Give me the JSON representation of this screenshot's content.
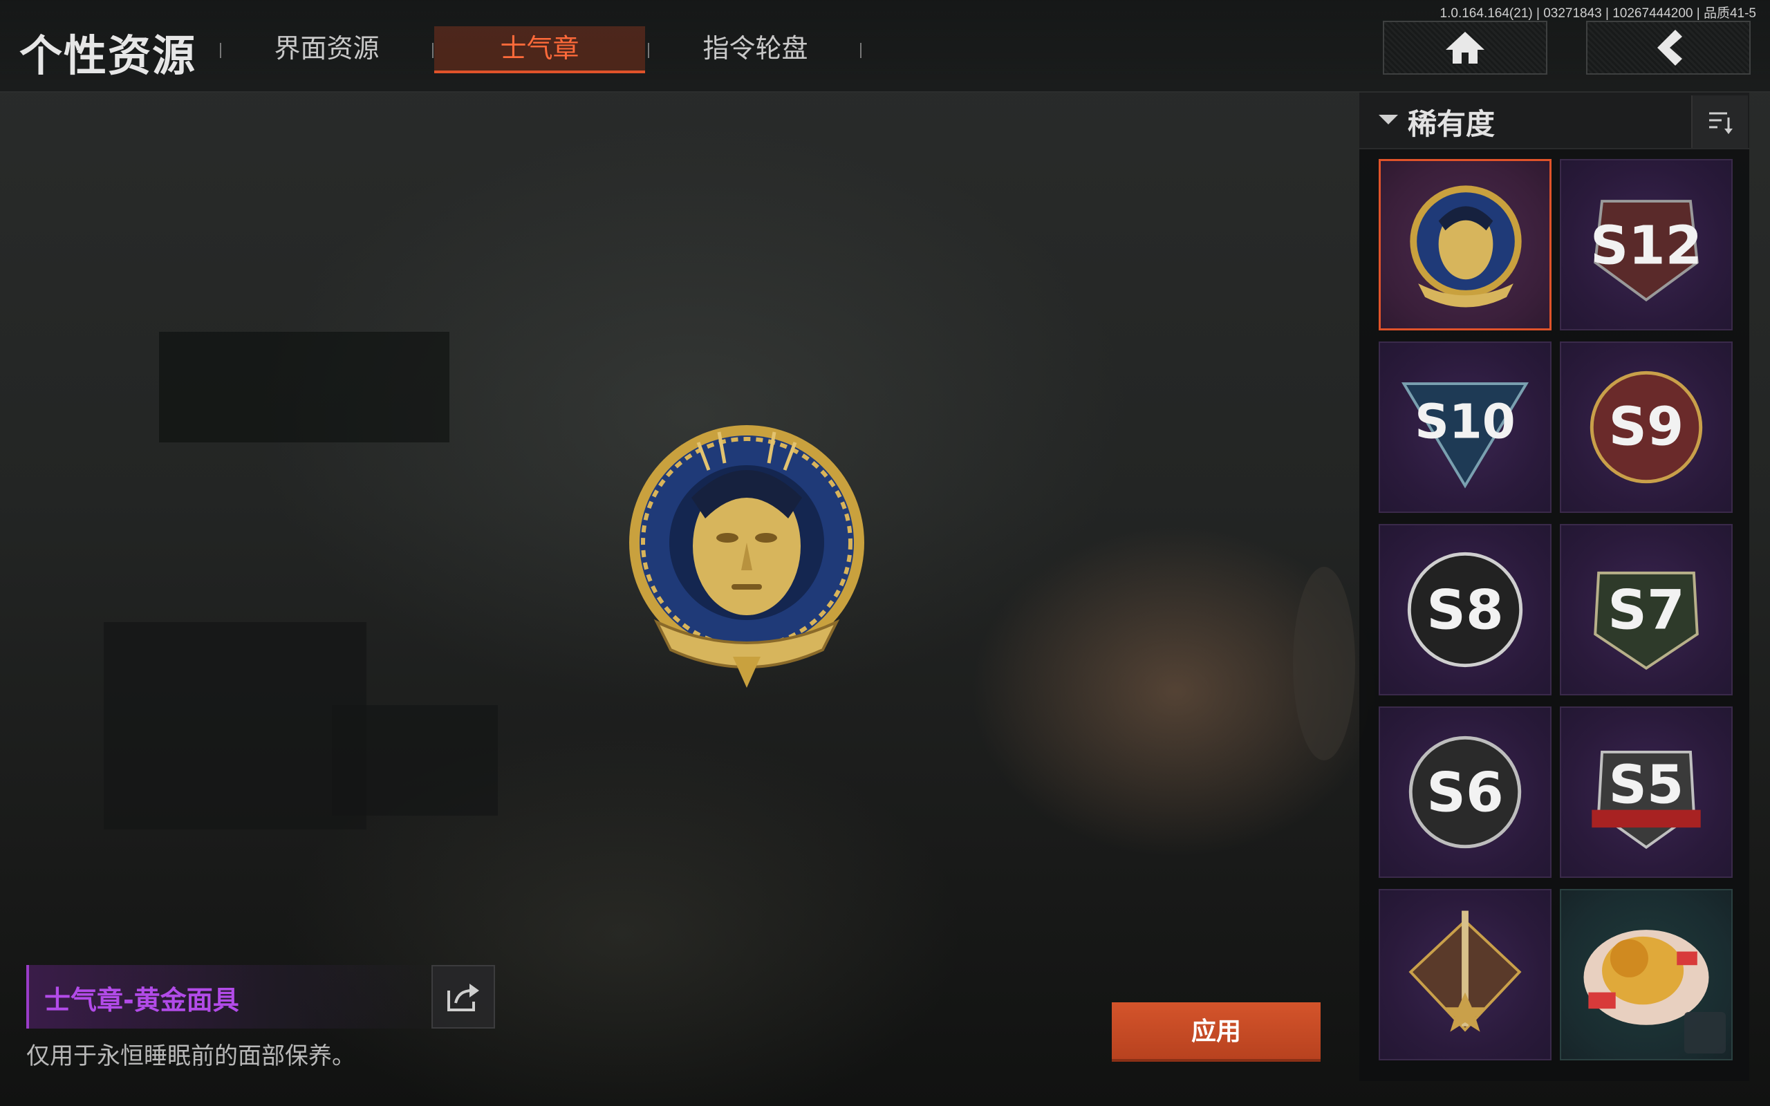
{
  "header": {
    "title": "个性资源",
    "tabs": [
      {
        "label": "界面资源",
        "active": false
      },
      {
        "label": "士气章",
        "active": true
      },
      {
        "label": "指令轮盘",
        "active": false
      }
    ],
    "version_info": "1.0.164.164(21) | 03271843 | 10267444200 | 品质41-5",
    "home_icon": "home-icon",
    "back_icon": "back-arrow-icon"
  },
  "filter": {
    "label": "稀有度",
    "sort_icon": "sort-icon"
  },
  "badges": [
    {
      "label": "",
      "name": "gold-mask",
      "selected": true
    },
    {
      "label": "S12",
      "name": "season-12"
    },
    {
      "label": "S10",
      "name": "season-10"
    },
    {
      "label": "S9",
      "name": "season-9"
    },
    {
      "label": "S8",
      "name": "season-8"
    },
    {
      "label": "S7",
      "name": "season-7"
    },
    {
      "label": "S6",
      "name": "season-6"
    },
    {
      "label": "S5",
      "name": "season-5"
    },
    {
      "label": "",
      "name": "dagger-star"
    },
    {
      "label": "",
      "name": "golden-lion"
    }
  ],
  "selected_item": {
    "name": "士气章-黄金面具",
    "description": "仅用于永恒睡眠前的面部保养。",
    "share_icon": "share-icon"
  },
  "apply_label": "应用",
  "colors": {
    "accent": "#e0532a",
    "item_purple": "#b24be8",
    "tile_bg": "#2a1a3b"
  }
}
